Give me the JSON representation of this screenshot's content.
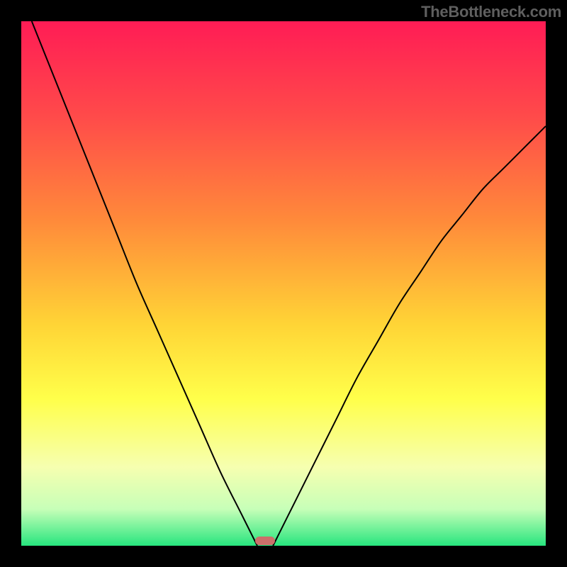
{
  "attribution": "TheBottleneck.com",
  "chart_data": {
    "type": "line",
    "title": "",
    "xlabel": "",
    "ylabel": "",
    "xlim": [
      0,
      100
    ],
    "ylim": [
      0,
      100
    ],
    "gradient_stops": [
      {
        "pct": 0,
        "color": "#ff1c55"
      },
      {
        "pct": 18,
        "color": "#ff4a4a"
      },
      {
        "pct": 38,
        "color": "#ff8a3a"
      },
      {
        "pct": 58,
        "color": "#ffd536"
      },
      {
        "pct": 72,
        "color": "#ffff4a"
      },
      {
        "pct": 85,
        "color": "#f6ffb0"
      },
      {
        "pct": 93,
        "color": "#c7ffb8"
      },
      {
        "pct": 100,
        "color": "#27e57e"
      }
    ],
    "series": [
      {
        "name": "left-branch",
        "x": [
          2,
          6,
          10,
          14,
          18,
          22,
          26,
          30,
          34,
          38,
          42,
          45
        ],
        "values": [
          100,
          90,
          80,
          70,
          60,
          50,
          41,
          32,
          23,
          14,
          6,
          0
        ]
      },
      {
        "name": "right-branch",
        "x": [
          48,
          52,
          56,
          60,
          64,
          68,
          72,
          76,
          80,
          84,
          88,
          92,
          96,
          100
        ],
        "values": [
          0,
          8,
          16,
          24,
          32,
          39,
          46,
          52,
          58,
          63,
          68,
          72,
          76,
          80
        ]
      }
    ],
    "marker": {
      "x": 46.5,
      "y": 1
    }
  }
}
